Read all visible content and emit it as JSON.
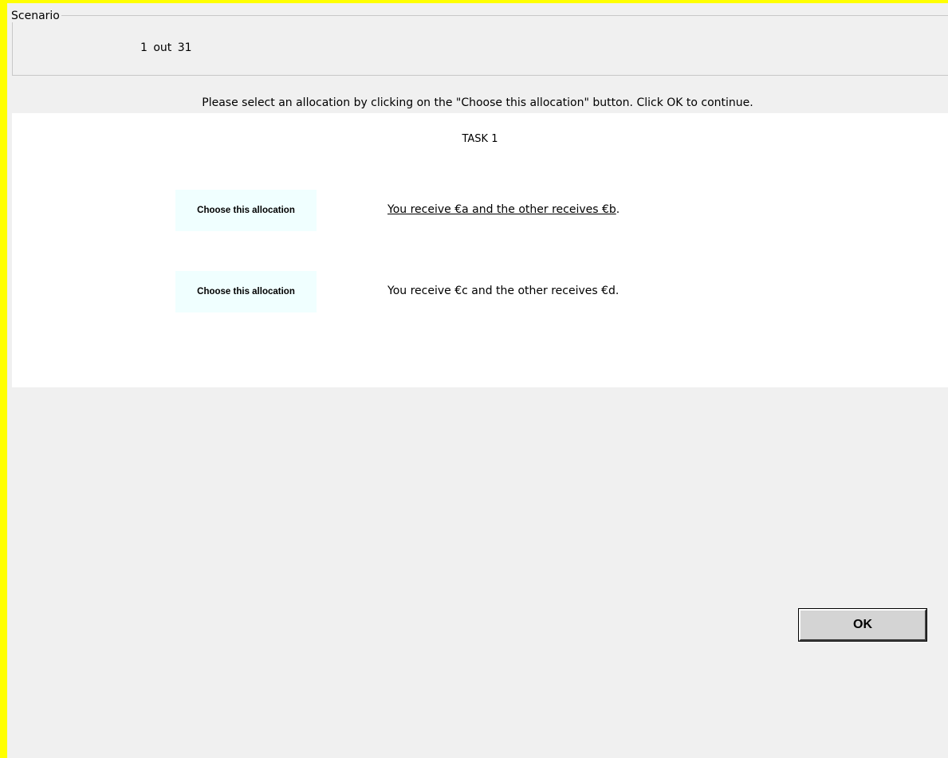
{
  "scenario": {
    "legend": "Scenario",
    "counter": "1 out 31"
  },
  "instructions": "Please select an allocation by clicking on the \"Choose this allocation\" button. Click OK to continue.",
  "task": {
    "title": "TASK 1",
    "allocations": [
      {
        "button_label": "Choose this allocation",
        "description": "You receive €a and the other receives €b",
        "suffix": "."
      },
      {
        "button_label": "Choose this allocation",
        "description": "You receive €c and the other receives €d",
        "suffix": "."
      }
    ]
  },
  "ok_button": {
    "label": "OK"
  },
  "colors": {
    "window_border": "#ffff00",
    "background": "#f0f0f0",
    "panel": "#ffffff",
    "allocation_button": "#f0ffff",
    "ok_button": "#d4d4d4"
  }
}
